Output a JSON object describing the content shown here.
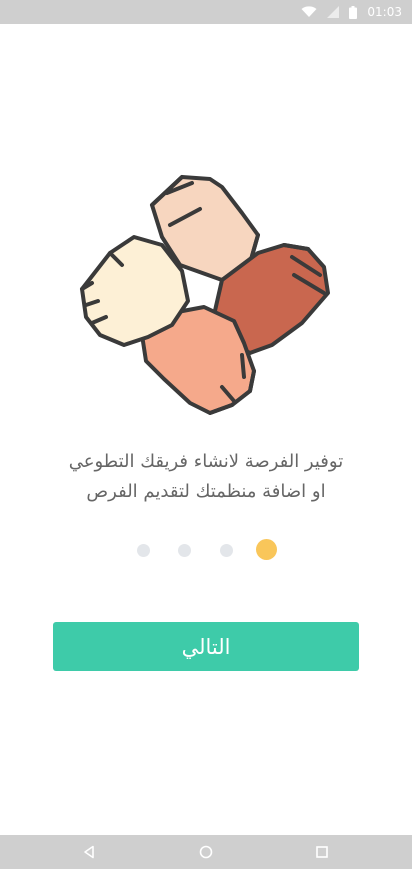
{
  "status_bar": {
    "time": "01:03",
    "icons": [
      "wifi-icon",
      "signal-icon",
      "battery-icon"
    ]
  },
  "onboarding": {
    "line1": "توفير الفرصة لانشاء فريقك التطوعي",
    "line2": "او اضافة منظمتك لتقديم الفرص",
    "page_count": 4,
    "active_page": 4,
    "next_label": "التالي"
  },
  "colors": {
    "accent": "#3ecba9",
    "active_dot": "#f9c65a",
    "inactive_dot": "#e3e6ea"
  },
  "nav_bar": {
    "icons": [
      "back-icon",
      "home-icon",
      "recents-icon"
    ]
  }
}
